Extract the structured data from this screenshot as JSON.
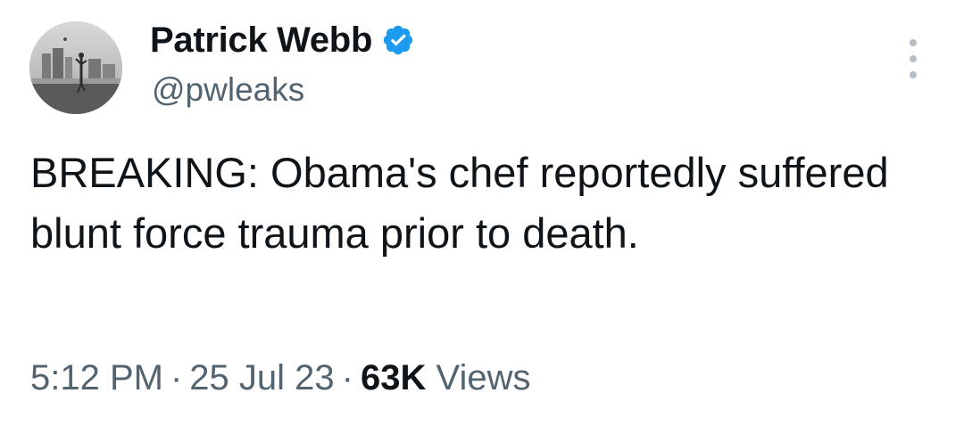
{
  "author": {
    "display_name": "Patrick Webb",
    "handle": "@pwleaks",
    "verified": true,
    "verified_icon": "verified-badge-icon",
    "verified_color": "#1d9bf0",
    "avatar": "profile-photo-grayscale-beach-skyline"
  },
  "more_menu": {
    "icon": "more-vertical-icon"
  },
  "tweet": {
    "text": "BREAKING: Obama's chef reportedly suffered blunt force trauma prior to death."
  },
  "meta": {
    "time": "5:12 PM",
    "separator": "·",
    "date": "25 Jul 23",
    "views_count": "63K",
    "views_label": "Views"
  },
  "colors": {
    "primary_text": "#0f1419",
    "secondary_text": "#536471",
    "accent": "#1d9bf0"
  }
}
